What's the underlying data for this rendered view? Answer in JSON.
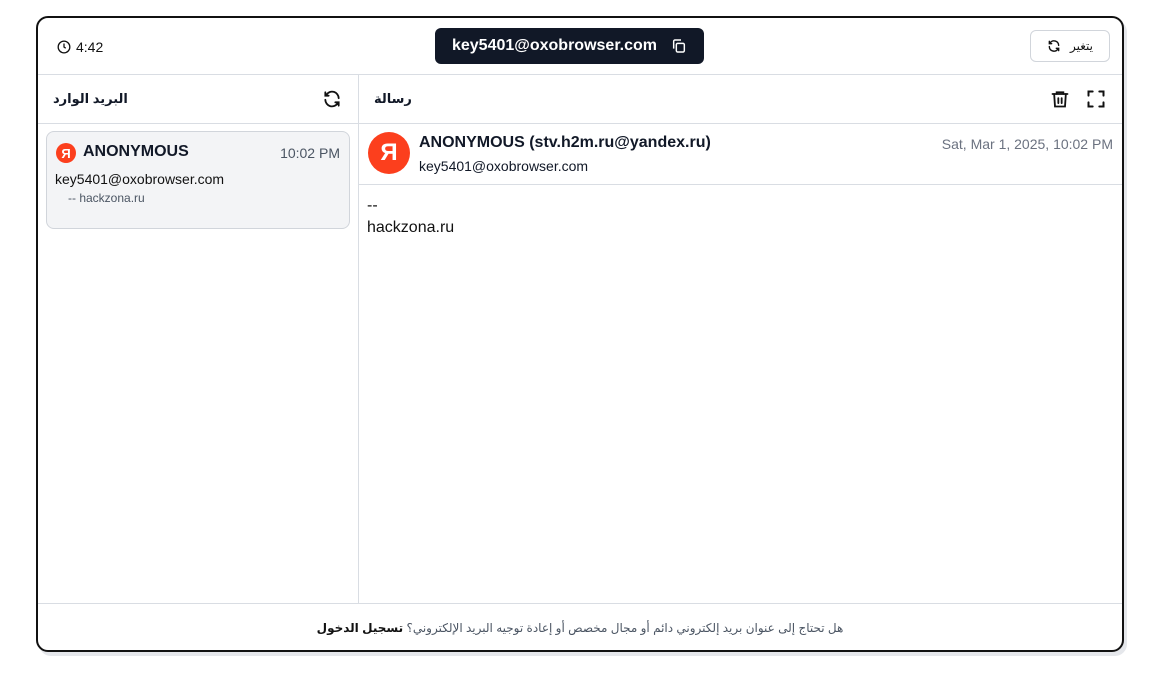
{
  "topbar": {
    "timer": "4:42",
    "email": "key5401@oxobrowser.com",
    "change_label": "يتغير"
  },
  "inbox": {
    "title": "البريد الوارد",
    "messages": [
      {
        "avatar_letter": "Я",
        "from": "ANONYMOUS",
        "time": "10:02 PM",
        "to": "key5401@oxobrowser.com",
        "snippet": "--  hackzona.ru"
      }
    ]
  },
  "message": {
    "title": "رسالة",
    "avatar_letter": "Я",
    "from": "ANONYMOUS (stv.h2m.ru@yandex.ru)",
    "to": "key5401@oxobrowser.com",
    "date": "Sat, Mar 1, 2025, 10:02 PM",
    "body_line1": "--",
    "body_line2": "hackzona.ru"
  },
  "footer": {
    "text": "هل تحتاج إلى عنوان بريد إلكتروني دائم أو مجال مخصص أو إعادة توجيه البريد الإلكتروني؟",
    "link": "تسجيل الدخول"
  },
  "colors": {
    "pill_bg": "#111827",
    "yandex_red": "#fc3f1d"
  },
  "icons": [
    "clock-icon",
    "copy-icon",
    "refresh-icon",
    "trash-icon",
    "expand-icon"
  ]
}
